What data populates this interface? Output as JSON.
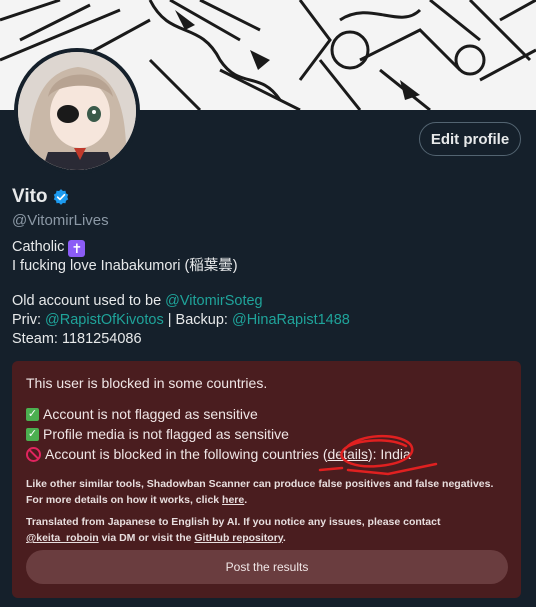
{
  "profile": {
    "name": "Vito",
    "handle": "@VitomirLives",
    "edit_button": "Edit profile",
    "bio": {
      "line1": "Catholic",
      "line1_badge": "✝",
      "line2": "I fucking love Inabakumori (稲葉曇)",
      "line3_prefix": "Old account used to be ",
      "line3_link": "@VitomirSoteg",
      "line4_prefix": "Priv: ",
      "line4_link1": "@RapistOfKivotos",
      "line4_mid": " | Backup: ",
      "line4_link2": "@HinaRapist1488",
      "line5": "Steam: 1181254086"
    }
  },
  "shadowban_panel": {
    "title": "This user is blocked in some countries.",
    "items": [
      {
        "text": "Account is not flagged as sensitive",
        "status": "ok"
      },
      {
        "text": "Profile media is not flagged as sensitive",
        "status": "ok"
      }
    ],
    "blocked": {
      "prefix": "Account is blocked in the following countries (",
      "details_link": "details",
      "suffix": "): India"
    },
    "note1_a": "Like other similar tools, Shadowban Scanner can produce false positives and false negatives. For more details on how it works, click ",
    "note1_link": "here",
    "note1_end": ".",
    "note2_a": "Translated from Japanese to English by AI. If you notice any issues, please contact ",
    "note2_link1": "@keita_roboin",
    "note2_b": " via DM or visit the ",
    "note2_link2": "GitHub repository",
    "note2_end": ".",
    "post_button": "Post the results"
  },
  "colors": {
    "background": "#15202b",
    "panel": "#4a1d1f",
    "link": "#1fa39a",
    "verified": "#1d9bf0"
  }
}
